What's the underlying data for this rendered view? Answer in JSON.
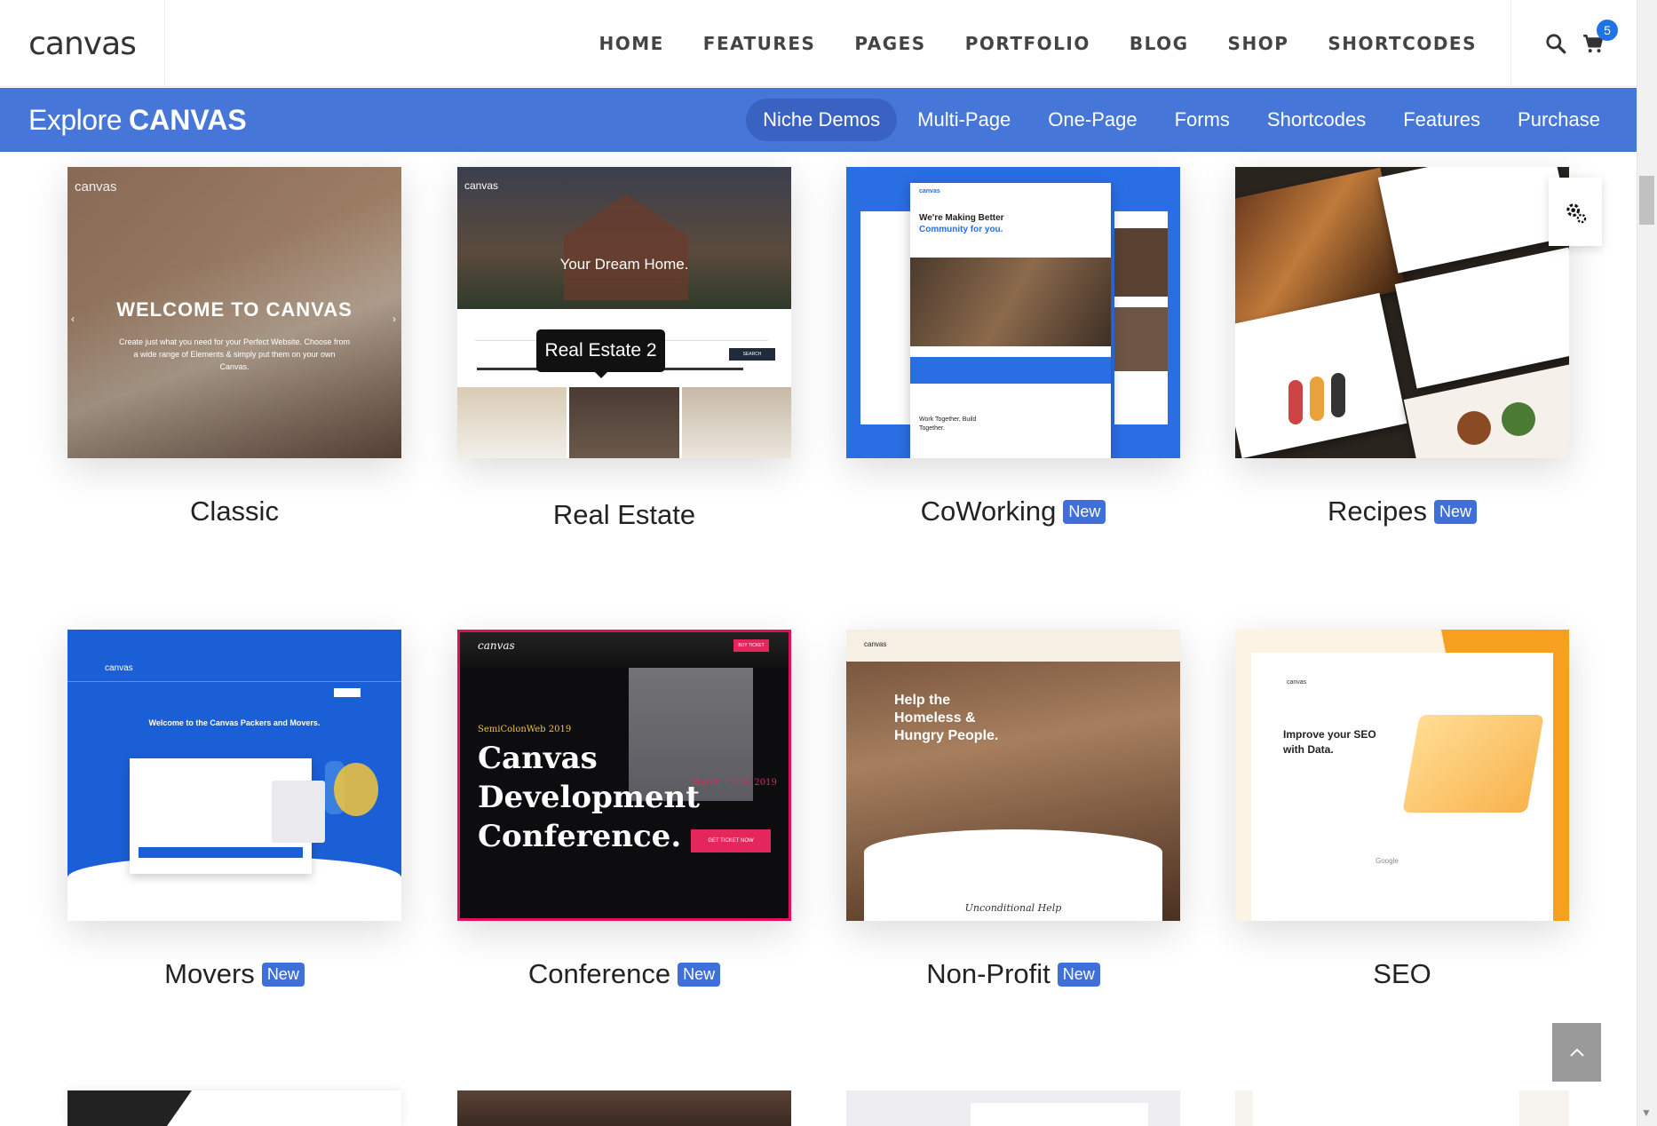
{
  "header": {
    "logo": "canvas",
    "nav": [
      "HOME",
      "FEATURES",
      "PAGES",
      "PORTFOLIO",
      "BLOG",
      "SHOP",
      "SHORTCODES"
    ],
    "cart_count": "5"
  },
  "explore": {
    "title_prefix": "Explore",
    "title_brand": "CANVAS",
    "nav": [
      "Niche Demos",
      "Multi-Page",
      "One-Page",
      "Forms",
      "Shortcodes",
      "Features",
      "Purchase"
    ],
    "active": "Niche Demos"
  },
  "demos": [
    {
      "name": "Classic",
      "is_new": false
    },
    {
      "name": "Real Estate",
      "is_new": false
    },
    {
      "name": "CoWorking",
      "is_new": true
    },
    {
      "name": "Recipes",
      "is_new": true
    },
    {
      "name": "Movers",
      "is_new": true
    },
    {
      "name": "Conference",
      "is_new": true
    },
    {
      "name": "Non-Profit",
      "is_new": true
    },
    {
      "name": "SEO",
      "is_new": false
    }
  ],
  "new_badge": "New",
  "tooltip": "Real Estate 2",
  "thumbs": {
    "classic": {
      "logo": "canvas",
      "heading": "WELCOME TO CANVAS",
      "text": "Create just what you need for your Perfect Website. Choose from a wide range of Elements & simply put them on your own Canvas."
    },
    "realestate": {
      "logo": "canvas",
      "heading": "Your Dream Home.",
      "button": "SEARCH"
    },
    "coworking": {
      "logo": "canvas",
      "heading_line1": "We're Making Better",
      "heading_line2": "Community for you.",
      "sub": "Work Together, Build Together."
    },
    "movers": {
      "logo": "canvas",
      "heading": "Welcome to the Canvas Packers and Movers."
    },
    "conference": {
      "logo": "canvas",
      "tag": "SemiColonWeb 2019",
      "title_line1": "Canvas",
      "title_line2": "Development",
      "title_line3": "Conference.",
      "date": "March 17-19, 2019",
      "button": "GET TICKET NOW",
      "buy": "BUY TICKET"
    },
    "nonprofit": {
      "logo": "canvas",
      "heading_line1": "Help the",
      "heading_line2": "Homeless &",
      "heading_line3": "Hungry People.",
      "sub": "Unconditional Help"
    },
    "seo": {
      "logo": "canvas",
      "heading_line1": "Improve your SEO",
      "heading_line2": "with Data.",
      "logos": [
        "Google"
      ]
    }
  },
  "colors": {
    "accent": "#4676d7",
    "active_pill": "#3a62c2",
    "badge": "#3f6fd8",
    "cart_badge": "#1e74e0"
  }
}
